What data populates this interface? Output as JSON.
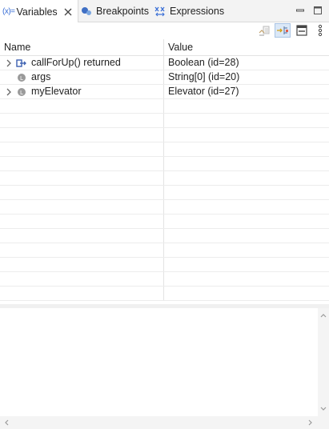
{
  "tabs": [
    {
      "icon": "variables-icon",
      "icon_text": "(x)=",
      "label": "Variables",
      "active": true
    },
    {
      "icon": "breakpoints-icon",
      "label": "Breakpoints",
      "active": false
    },
    {
      "icon": "expressions-icon",
      "label": "Expressions",
      "active": false
    }
  ],
  "window_controls": [
    "minimize-icon",
    "maximize-icon"
  ],
  "toolbar": [
    "collapse-all-icon",
    "show-logical-structure-icon",
    "layout-icon",
    "view-menu-icon"
  ],
  "columns": {
    "name": "Name",
    "value": "Value"
  },
  "variables": [
    {
      "name": "callForUp() returned",
      "value": "Boolean  (id=28)",
      "expandable": true,
      "icon": "method-result-icon"
    },
    {
      "name": "args",
      "value": "String[0]  (id=20)",
      "expandable": false,
      "icon": "local-variable-icon"
    },
    {
      "name": "myElevator",
      "value": "Elevator  (id=27)",
      "expandable": true,
      "icon": "local-variable-icon"
    }
  ],
  "detail_pane": {
    "text": ""
  },
  "colors": {
    "accent": "#3a6fd6",
    "toggle_on_bg": "#dbe8f7"
  }
}
